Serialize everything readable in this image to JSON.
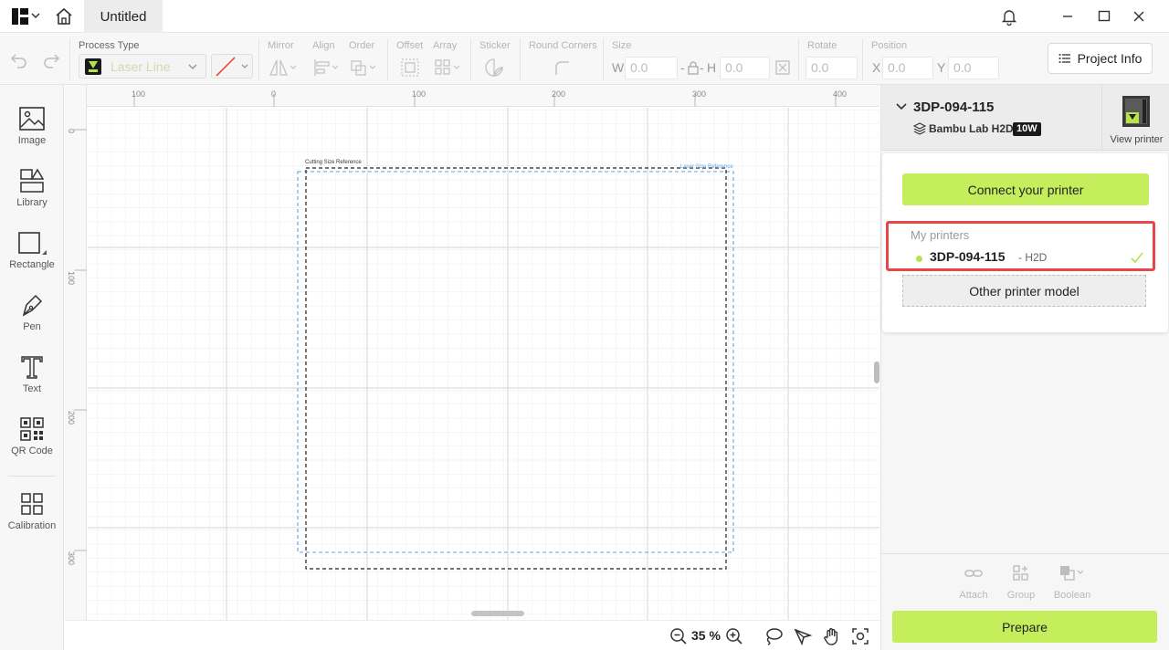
{
  "titlebar": {
    "tab_title": "Untitled"
  },
  "toolbar": {
    "process_type_label": "Process Type",
    "process_type_value": "Laser Line",
    "mirror_label": "Mirror",
    "align_label": "Align",
    "order_label": "Order",
    "offset_label": "Offset",
    "array_label": "Array",
    "sticker_label": "Sticker",
    "round_corners_label": "Round Corners",
    "size_label": "Size",
    "w_label": "W",
    "w_value": "0.0",
    "h_label": "H",
    "h_value": "0.0",
    "rotate_label": "Rotate",
    "rotate_value": "0.0",
    "position_label": "Position",
    "x_label": "X",
    "x_value": "0.0",
    "y_label": "Y",
    "y_value": "0.0",
    "project_info_label": "Project Info"
  },
  "sidebar": {
    "items": [
      {
        "label": "Image"
      },
      {
        "label": "Library"
      },
      {
        "label": "Rectangle"
      },
      {
        "label": "Pen"
      },
      {
        "label": "Text"
      },
      {
        "label": "QR Code"
      },
      {
        "label": "Calibration"
      }
    ]
  },
  "canvas": {
    "ruler_top": [
      "100",
      "0",
      "100",
      "200",
      "300",
      "400"
    ],
    "ruler_left": [
      "0",
      "100",
      "200",
      "300"
    ],
    "cutting_ref_label": "Cutting Size Reference",
    "laser_ref_label": "Laser Size Reference",
    "zoom_value": "35 %"
  },
  "device": {
    "name": "3DP-094-115",
    "model": "Bambu Lab H2D",
    "badge": "10W",
    "view_printer_label": "View printer"
  },
  "dropdown": {
    "connect_label": "Connect your printer",
    "my_printers_header": "My printers",
    "printer_name": "3DP-094-115",
    "printer_model": "- H2D",
    "other_model_label": "Other printer model"
  },
  "bottom_tools": {
    "attach_label": "Attach",
    "group_label": "Group",
    "boolean_label": "Boolean",
    "prepare_label": "Prepare"
  },
  "colors": {
    "accent_green": "#c4ee5b",
    "highlight_red": "#e7464b",
    "laser_ref_blue": "#5aa5e8",
    "status_dot": "#b5e34b"
  }
}
